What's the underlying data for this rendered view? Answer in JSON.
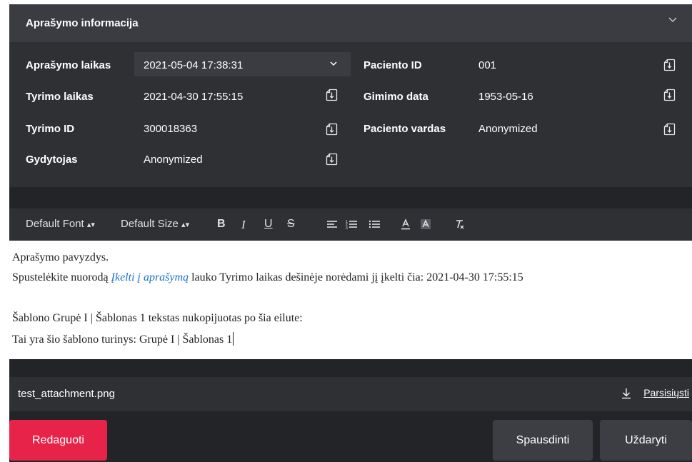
{
  "section": {
    "title": "Aprašymo informacija"
  },
  "info": {
    "description_time_label": "Aprašymo laikas",
    "description_time_value": "2021-05-04 17:38:31",
    "study_time_label": "Tyrimo laikas",
    "study_time_value": "2021-04-30 17:55:15",
    "study_id_label": "Tyrimo ID",
    "study_id_value": "300018363",
    "doctor_label": "Gydytojas",
    "doctor_value": "Anonymized",
    "patient_id_label": "Paciento ID",
    "patient_id_value": "001",
    "birth_date_label": "Gimimo data",
    "birth_date_value": "1953-05-16",
    "patient_name_label": "Paciento vardas",
    "patient_name_value": "Anonymized"
  },
  "toolbar": {
    "font": "Default Font",
    "size": "Default Size",
    "bold": "B",
    "italic": "I",
    "underline": "U",
    "strike": "S"
  },
  "editor": {
    "line1": "Aprašymo pavyzdys.",
    "line2_before": "Spustelėkite nuorodą ",
    "line2_link": "Įkelti į aprašymą",
    "line2_after": " lauko Tyrimo laikas dešinėje norėdami jį įkelti čia: 2021-04-30 17:55:15",
    "line3": "Šablono Grupė I | Šablonas 1 tekstas nukopijuotas po šia eilute:",
    "line4": "Tai yra šio šablono turinys: Grupė I | Šablonas 1"
  },
  "attachment": {
    "filename": "test_attachment.png",
    "download_label": "Parsisiųsti"
  },
  "footer": {
    "edit_label": "Redaguoti",
    "print_label": "Spausdinti",
    "close_label": "Uždaryti"
  },
  "colors": {
    "accent_red": "#e8234a",
    "link_blue": "#1a73c8",
    "panel_dark": "#2e3034",
    "header_dark": "#3a3c42"
  }
}
